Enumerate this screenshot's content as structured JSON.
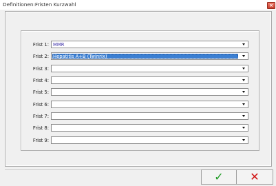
{
  "window": {
    "title": "Definitionen:Fristen Kurzwahl",
    "close_icon": "close-icon"
  },
  "rows": [
    {
      "label": "Frist 1:",
      "value": "MMR",
      "selected": false
    },
    {
      "label": "Frist 2:",
      "value": "Hepatitis A+B (Twinrix)",
      "selected": true
    },
    {
      "label": "Frist 3:",
      "value": "",
      "selected": false
    },
    {
      "label": "Frist 4:",
      "value": "",
      "selected": false
    },
    {
      "label": "Frist 5:",
      "value": "",
      "selected": false
    },
    {
      "label": "Frist 6:",
      "value": "",
      "selected": false
    },
    {
      "label": "Frist 7:",
      "value": "",
      "selected": false
    },
    {
      "label": "Frist 8:",
      "value": "",
      "selected": false
    },
    {
      "label": "Frist 9:",
      "value": "",
      "selected": false
    }
  ],
  "buttons": {
    "ok_icon": "checkmark-icon",
    "ok_glyph": "✓",
    "cancel_icon": "x-icon",
    "cancel_glyph": "✕"
  },
  "colors": {
    "value_text": "#3c2fa8",
    "selection": "#3b7fd2",
    "ok": "#1a9a20",
    "cancel": "#d01010"
  }
}
